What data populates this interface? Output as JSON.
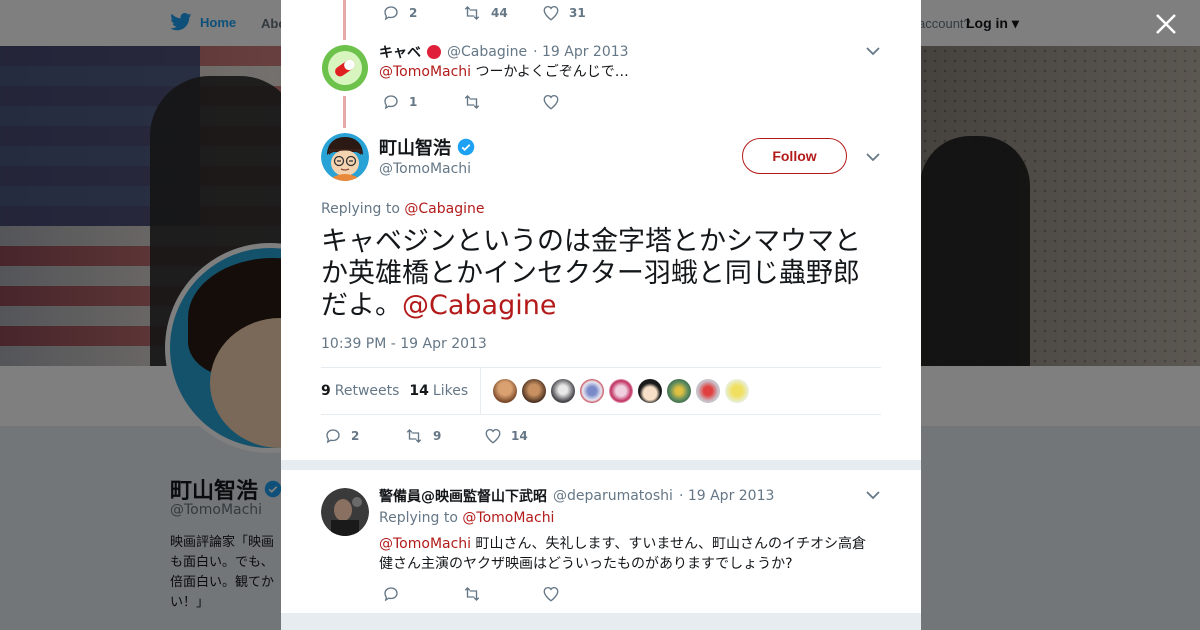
{
  "bg": {
    "nav_home": "Home",
    "nav_about": "Abo",
    "nav_account": "account?",
    "nav_login": "Log in",
    "profile_name": "町山智浩",
    "profile_handle": "@TomoMachi",
    "profile_bio": "映画評論家「映画\nも面白い。でも、\n倍面白い。観てか\nい！」"
  },
  "colors": {
    "link": "#b31b1b",
    "twitter_blue": "#1da1f2",
    "verified": "#1da1f2",
    "muted": "#657786"
  },
  "top_actions": {
    "reply": "2",
    "retweet": "44",
    "like": "31"
  },
  "reply1": {
    "name": "キャベ",
    "handle": "@Cabagine",
    "date": "· 19 Apr 2013",
    "mention": "@TomoMachi",
    "text": " つーかよくごぞんじで…",
    "reply_count": "1",
    "retweet_count": "",
    "like_count": ""
  },
  "main": {
    "name": "町山智浩",
    "handle": "@TomoMachi",
    "follow_label": "Follow",
    "replying_prefix": "Replying to ",
    "replying_to": "@Cabagine",
    "text": "キャベジンというのは金字塔とかシマウマとか英雄橋とかインセクター羽蛾と同じ蟲野郎だよ。",
    "text_mention": "@Cabagine",
    "timestamp": "10:39 PM - 19 Apr 2013",
    "retweets": "9",
    "retweets_label": "Retweets",
    "likes": "14",
    "likes_label": "Likes",
    "reply_count": "2",
    "retweet_count": "9",
    "like_count": "14"
  },
  "reply2": {
    "name": "警備員@映画監督山下武昭",
    "handle": "@deparumatoshi",
    "date": "· 19 Apr 2013",
    "replying_prefix": "Replying to ",
    "replying_to": "@TomoMachi",
    "mention": "@TomoMachi",
    "text": " 町山さん、失礼します、すいません、町山さんのイチオシ高倉健さん主演のヤクザ映画はどういったものがありますでしょうか?"
  },
  "icons": [
    "twitter-bird-icon",
    "close-icon",
    "reply-icon",
    "retweet-icon",
    "heart-icon",
    "chevron-down-icon",
    "verified-badge-icon"
  ]
}
